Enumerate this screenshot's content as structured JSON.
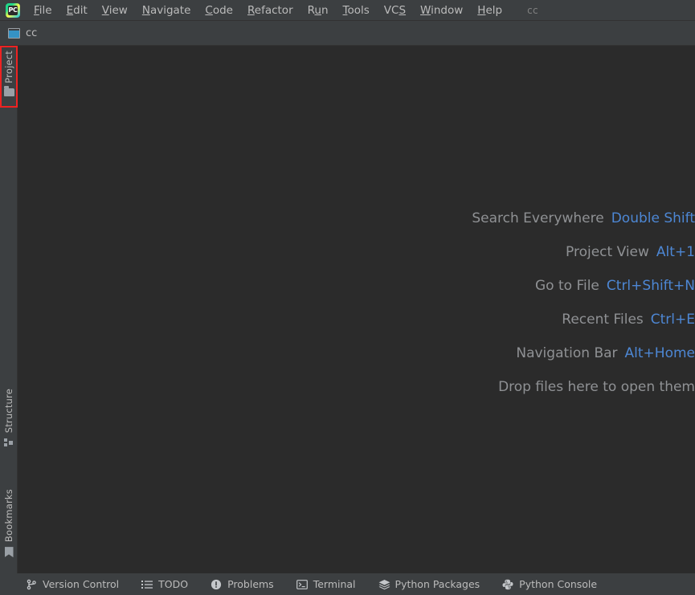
{
  "window": {
    "app_icon": "pycharm-logo-icon",
    "app_initials": "PC",
    "project_name": "cc"
  },
  "menubar": {
    "items": [
      {
        "label": "File",
        "mnemonic": "F"
      },
      {
        "label": "Edit",
        "mnemonic": "E"
      },
      {
        "label": "View",
        "mnemonic": "V"
      },
      {
        "label": "Navigate",
        "mnemonic": "N"
      },
      {
        "label": "Code",
        "mnemonic": "C"
      },
      {
        "label": "Refactor",
        "mnemonic": "R"
      },
      {
        "label": "Run",
        "mnemonic": "u"
      },
      {
        "label": "Tools",
        "mnemonic": "T"
      },
      {
        "label": "VCS",
        "mnemonic": "S"
      },
      {
        "label": "Window",
        "mnemonic": "W"
      },
      {
        "label": "Help",
        "mnemonic": "H"
      }
    ],
    "project_label": "cc"
  },
  "navbar": {
    "crumb_label": "cc",
    "crumb_icon": "project-module-icon"
  },
  "left_stripe": {
    "top_buttons": [
      {
        "label": "Project",
        "icon": "folder-icon",
        "highlighted": true
      }
    ],
    "bottom_buttons": [
      {
        "label": "Structure",
        "icon": "structure-icon"
      },
      {
        "label": "Bookmarks",
        "icon": "bookmark-icon"
      }
    ],
    "highlight_color": "#ee2222"
  },
  "editor": {
    "hints": [
      {
        "label": "Search Everywhere",
        "key": "Double Shift"
      },
      {
        "label": "Project View",
        "key": "Alt+1"
      },
      {
        "label": "Go to File",
        "key": "Ctrl+Shift+N"
      },
      {
        "label": "Recent Files",
        "key": "Ctrl+E"
      },
      {
        "label": "Navigation Bar",
        "key": "Alt+Home"
      },
      {
        "label": "Drop files here to open them",
        "key": ""
      }
    ]
  },
  "statusbar": {
    "items": [
      {
        "label": "Version Control",
        "icon": "branch-icon"
      },
      {
        "label": "TODO",
        "icon": "list-icon"
      },
      {
        "label": "Problems",
        "icon": "exclamation-circle-icon"
      },
      {
        "label": "Terminal",
        "icon": "terminal-icon"
      },
      {
        "label": "Python Packages",
        "icon": "layers-icon"
      },
      {
        "label": "Python Console",
        "icon": "python-icon"
      }
    ]
  },
  "colors": {
    "editor_bg": "#2b2b2b",
    "chrome_bg": "#3c3f41",
    "text": "#bbbbbb",
    "hint_label": "#8f9194",
    "hint_key": "#4d87d4",
    "accent_red": "#ee2222"
  }
}
